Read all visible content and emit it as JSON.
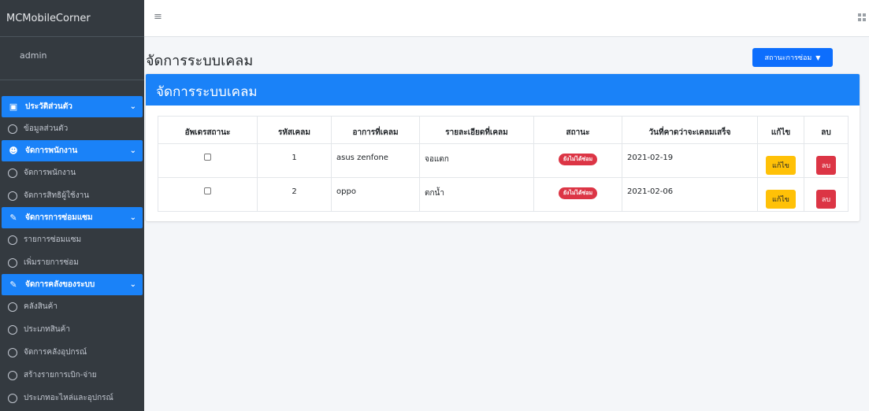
{
  "app": {
    "brand": "MCMobileCorner",
    "user": "admin"
  },
  "sidebar": {
    "groups": [
      {
        "label": "ประวัติส่วนตัว",
        "icon": "id-card-icon",
        "items": [
          "ข้อมูลส่วนตัว"
        ]
      },
      {
        "label": "จัดการพนักงาน",
        "icon": "users-icon",
        "items": [
          "จัดการพนักงาน",
          "จัดการสิทธิผู้ใช้งาน"
        ]
      },
      {
        "label": "จัดการการซ่อมแซม",
        "icon": "wrench-icon",
        "items": [
          "รายการซ่อมแซม",
          "เพิ่มรายการซ่อม"
        ]
      },
      {
        "label": "จัดการคลังของระบบ",
        "icon": "wrench-icon",
        "items": [
          "คลังสินค้า",
          "ประเภทสินค้า",
          "จัดการคลังอุปกรณ์",
          "สร้างรายการเบิก-จ่าย",
          "ประเภทอะไหล่และอุปกรณ์"
        ]
      }
    ]
  },
  "header": {
    "title": "จัดการระบบเคลม",
    "status_button": "สถานะการซ่อม"
  },
  "card": {
    "title": "จัดการระบบเคลม",
    "columns": [
      "อัพเดรสถานะ",
      "รหัสเคลม",
      "อาการที่เคลม",
      "รายละเอียดที่เคลม",
      "สถานะ",
      "วันที่คาดว่าจะเคลมเสร็จ",
      "แก้ไข",
      "ลบ"
    ],
    "rows": [
      {
        "id": "1",
        "symptom": "asus zenfone",
        "detail": "จอแตก",
        "status": "ยังไม่ได้ซ่อม",
        "date": "2021-02-19",
        "edit": "แก้ไข",
        "delete": "ลบ"
      },
      {
        "id": "2",
        "symptom": "oppo",
        "detail": "ตกน้ำ",
        "status": "ยังไม่ได้ซ่อม",
        "date": "2021-02-06",
        "edit": "แก้ไข",
        "delete": "ลบ"
      }
    ]
  },
  "colors": {
    "primary": "#1a82f8",
    "sidebar_bg": "#343a40",
    "danger": "#dc3545",
    "warning": "#ffc107"
  }
}
